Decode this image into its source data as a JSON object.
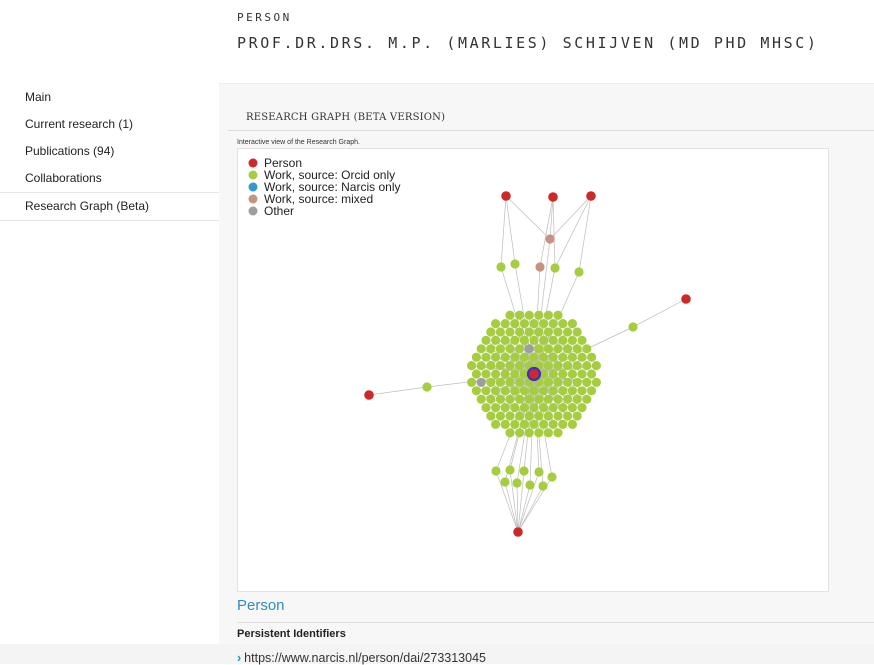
{
  "header": {
    "eyebrow": "PERSON",
    "title": "PROF.DR.DRS. M.P. (MARLIES) SCHIJVEN (MD PHD MHSC)"
  },
  "sidebar": {
    "items": [
      {
        "label": "Main"
      },
      {
        "label": "Current research (1)"
      },
      {
        "label": "Publications (94)"
      },
      {
        "label": "Collaborations"
      },
      {
        "label": "Research Graph (Beta)",
        "active": true
      }
    ]
  },
  "section": {
    "heading": "RESEARCH GRAPH (BETA VERSION)",
    "caption": "Interactive view of the Research Graph."
  },
  "graph": {
    "legend": [
      {
        "label": "Person",
        "color": "#cc2a2a"
      },
      {
        "label": "Work, source: Orcid only",
        "color": "#a6cd3f"
      },
      {
        "label": "Work, source: Narcis only",
        "color": "#2e9ad0"
      },
      {
        "label": "Work, source: mixed",
        "color": "#c79280"
      },
      {
        "label": "Other",
        "color": "#9e9e9e"
      }
    ]
  },
  "person_section": {
    "link_label": "Person",
    "ids_heading": "Persistent Identifiers",
    "identifier": "https://www.narcis.nl/person/dai/273313045"
  },
  "colors": {
    "accent": "#2a8fc4",
    "person_node": "#cc2a2a",
    "center_node": "#3a2fd0"
  }
}
